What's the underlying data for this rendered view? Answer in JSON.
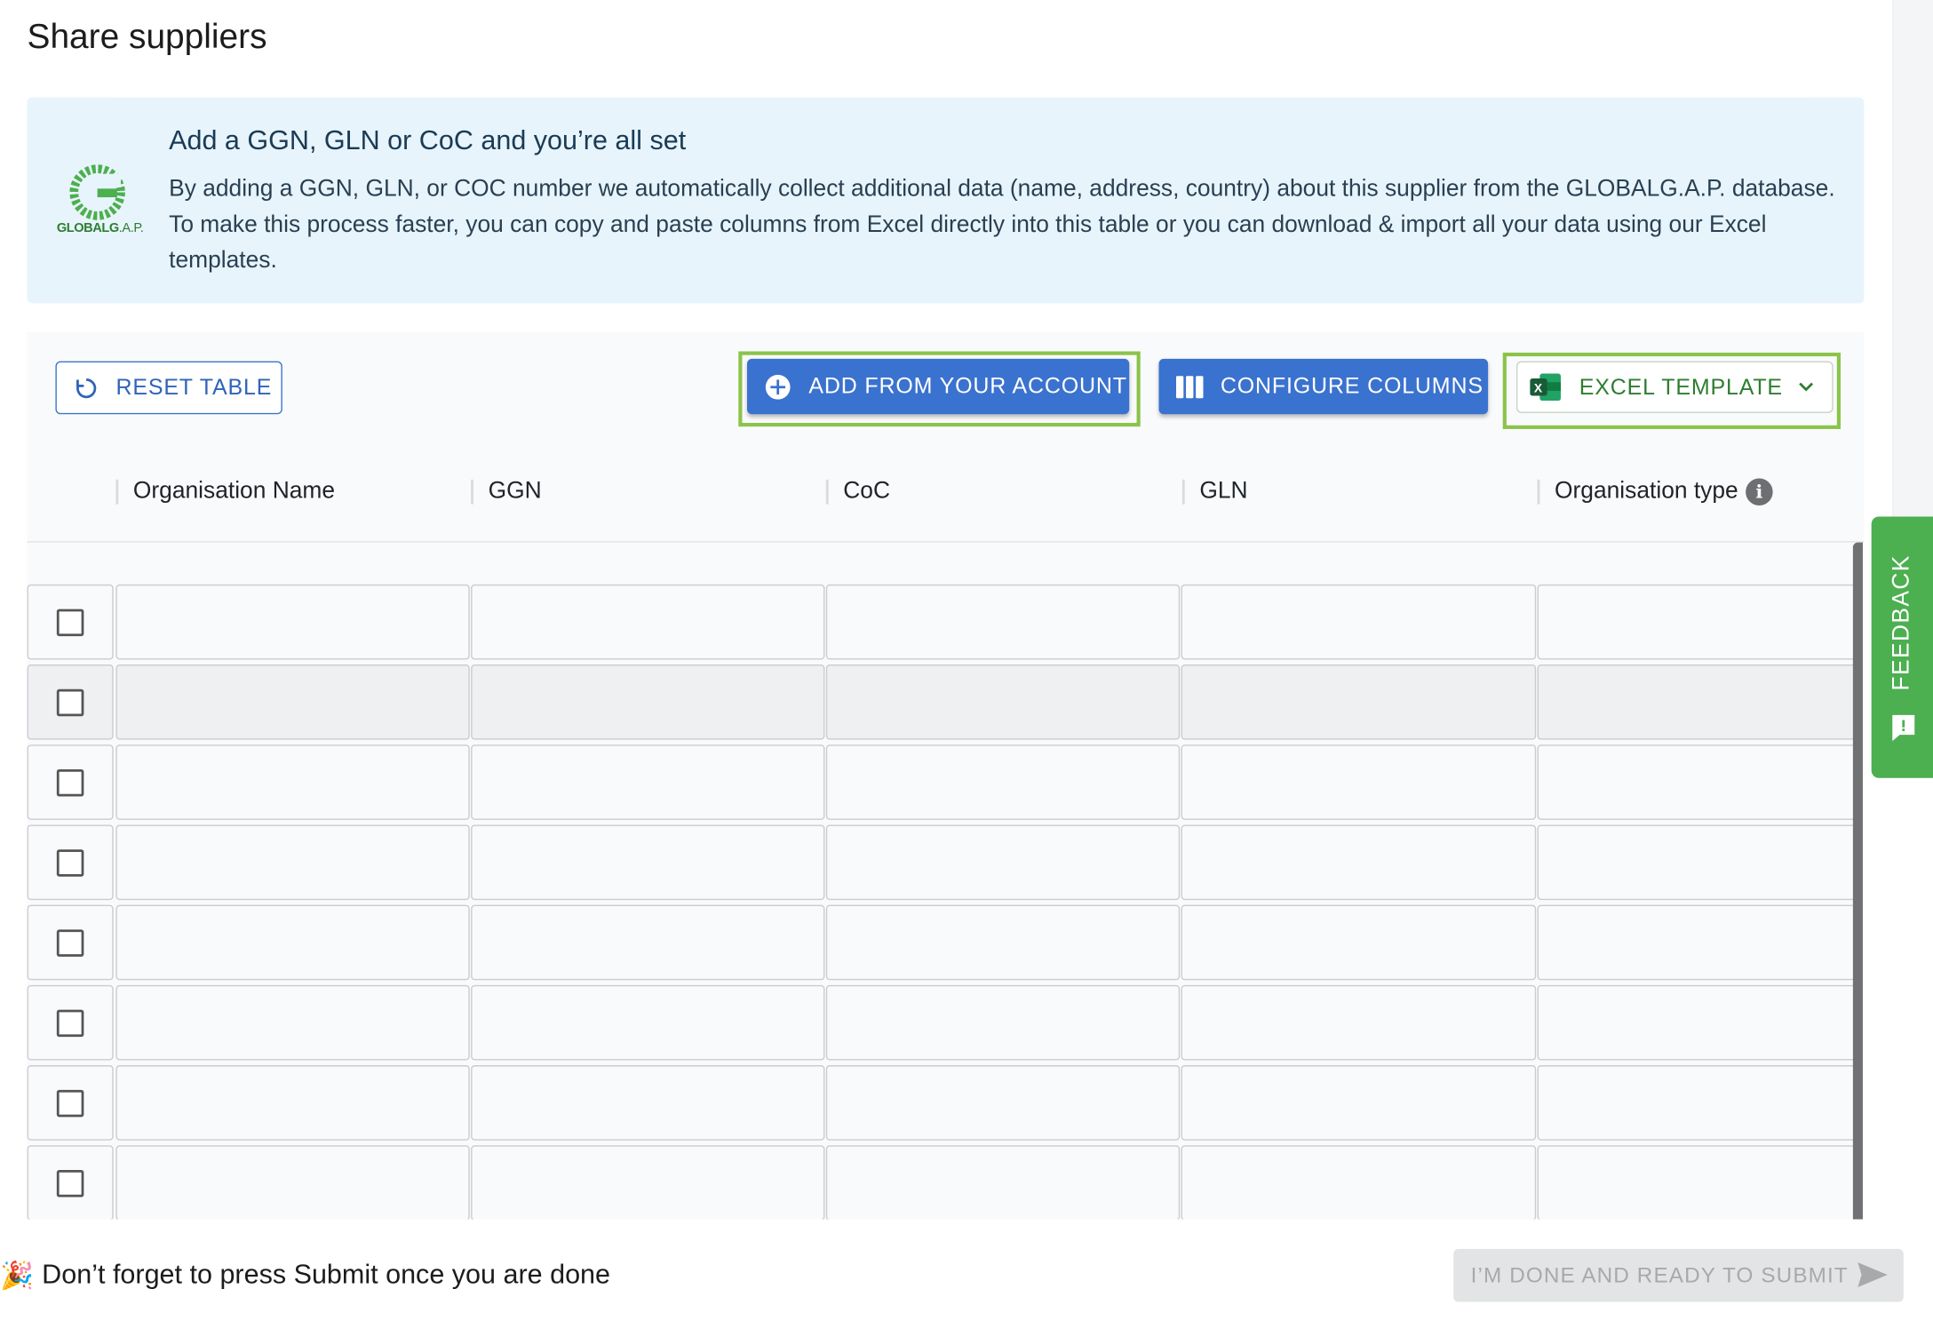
{
  "page": {
    "title": "Share suppliers"
  },
  "banner": {
    "heading": "Add a GGN, GLN or CoC and you’re all set",
    "body": "By adding a GGN, GLN, or COC number we automatically collect additional data (name, address, country) about this supplier from the GLOBALG.A.P. database. To make this process faster, you can copy and paste columns from Excel directly into this table or you can download & import all your data using our Excel templates.",
    "logo_text_bold": "GLOBALG",
    "logo_text_light": ".A.P."
  },
  "toolbar": {
    "reset_label": "RESET TABLE",
    "add_label": "ADD FROM YOUR ACCOUNT",
    "configure_label": "CONFIGURE COLUMNS",
    "excel_label": "EXCEL TEMPLATE"
  },
  "table": {
    "columns": [
      "Organisation Name",
      "GGN",
      "CoC",
      "GLN",
      "Organisation type"
    ],
    "row_count": 8
  },
  "feedback": {
    "label": "FEEDBACK"
  },
  "footer": {
    "emoji": "🎉",
    "text": "Don’t forget to press Submit once you are done",
    "submit_label": "I’M DONE AND READY TO SUBMIT"
  },
  "colors": {
    "primary": "#3a72cf",
    "highlight": "#8bc34a",
    "feedback": "#4caf50",
    "banner_bg": "#e7f4fb"
  }
}
